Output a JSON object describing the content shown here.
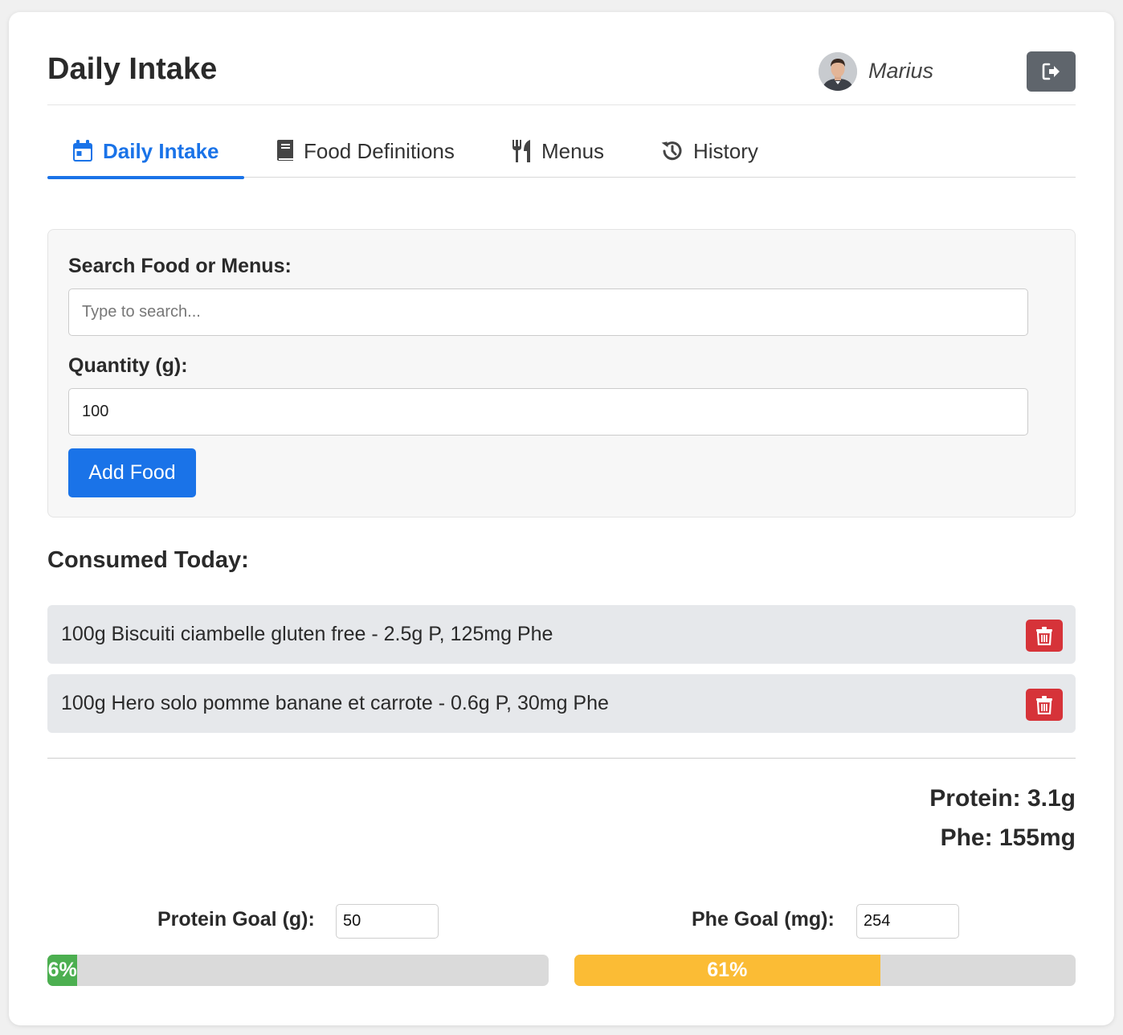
{
  "header": {
    "title": "Daily Intake",
    "username": "Marius"
  },
  "tabs": [
    {
      "label": "Daily Intake",
      "icon": "calendar-icon",
      "active": true
    },
    {
      "label": "Food Definitions",
      "icon": "book-icon",
      "active": false
    },
    {
      "label": "Menus",
      "icon": "utensils-icon",
      "active": false
    },
    {
      "label": "History",
      "icon": "history-icon",
      "active": false
    }
  ],
  "form": {
    "search_label": "Search Food or Menus:",
    "search_placeholder": "Type to search...",
    "search_value": "",
    "quantity_label": "Quantity (g):",
    "quantity_value": "100",
    "add_button": "Add Food"
  },
  "consumed": {
    "title": "Consumed Today:",
    "items": [
      {
        "text": "100g Biscuiti ciambelle gluten free - 2.5g P, 125mg Phe"
      },
      {
        "text": "100g Hero solo pomme banane et carrote - 0.6g P, 30mg Phe"
      }
    ]
  },
  "totals": {
    "protein": "Protein: 3.1g",
    "phe": "Phe: 155mg"
  },
  "goals": {
    "protein": {
      "label": "Protein Goal (g):",
      "value": "50",
      "percent": 6,
      "percent_label": "6%",
      "color": "#4caf50"
    },
    "phe": {
      "label": "Phe Goal (mg):",
      "value": "254",
      "percent": 61,
      "percent_label": "61%",
      "color": "#fbbc35"
    }
  },
  "colors": {
    "primary": "#1a73e8",
    "danger": "#d63339",
    "logout": "#5f656c"
  }
}
